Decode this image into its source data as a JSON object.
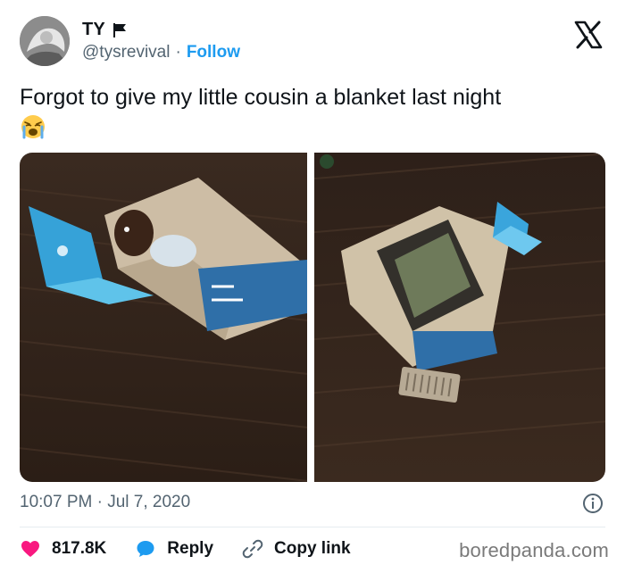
{
  "user": {
    "display_name": "TY",
    "handle": "@tysrevival",
    "separator": "·",
    "follow_label": "Follow"
  },
  "tweet": {
    "text": "Forgot to give my little cousin a blanket last night",
    "emoji": "loudly-crying-face",
    "timestamp": "10:07 PM · Jul 7, 2020"
  },
  "photos": [
    {
      "name": "photo-child-in-box"
    },
    {
      "name": "photo-box-and-laptop"
    }
  ],
  "actions": {
    "like_count": "817.8K",
    "reply_label": "Reply",
    "copy_link_label": "Copy link"
  },
  "watermark": "boredpanda.com",
  "colors": {
    "accent": "#1d9bf0",
    "like": "#f91880",
    "secondary_text": "#536471"
  }
}
